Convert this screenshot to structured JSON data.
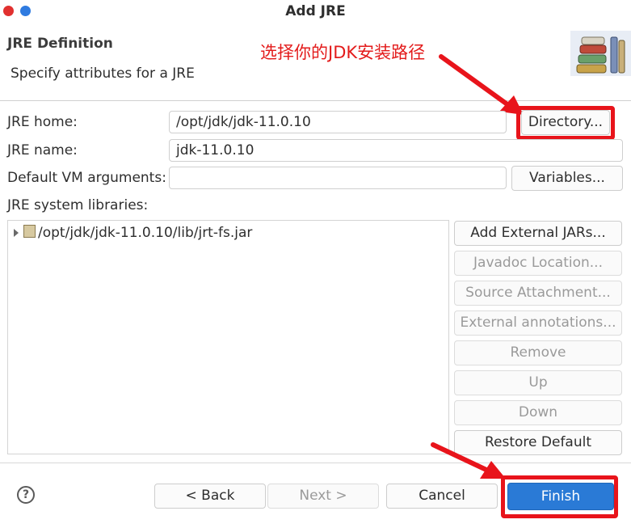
{
  "window": {
    "title": "Add JRE",
    "controls": [
      "close",
      "minimize"
    ],
    "colors": {
      "close": "#e1302f",
      "minimize": "#2f7be0"
    }
  },
  "header": {
    "title": "JRE Definition",
    "subtitle": "Specify attributes for a JRE",
    "annotation": "选择你的JDK安装路径",
    "annotation_color": "#e31b1b",
    "logo_icon": "books-icon"
  },
  "form": {
    "jre_home": {
      "label": "JRE home:",
      "value": "/opt/jdk/jdk-11.0.10",
      "button": "Directory..."
    },
    "jre_name": {
      "label": "JRE name:",
      "value": "jdk-11.0.10"
    },
    "vm_args": {
      "label": "Default VM arguments:",
      "value": "",
      "button": "Variables..."
    },
    "libraries_label": "JRE system libraries:"
  },
  "libraries": [
    {
      "path": "/opt/jdk/jdk-11.0.10/lib/jrt-fs.jar",
      "icon": "jar-icon"
    }
  ],
  "library_buttons": [
    {
      "label": "Add External JARs...",
      "enabled": true
    },
    {
      "label": "Javadoc Location...",
      "enabled": false
    },
    {
      "label": "Source Attachment...",
      "enabled": false
    },
    {
      "label": "External annotations...",
      "enabled": false
    },
    {
      "label": "Remove",
      "enabled": false
    },
    {
      "label": "Up",
      "enabled": false
    },
    {
      "label": "Down",
      "enabled": false
    },
    {
      "label": "Restore Default",
      "enabled": true
    }
  ],
  "footer": {
    "help_icon": "help-icon",
    "back": "< Back",
    "next": "Next >",
    "cancel": "Cancel",
    "finish": "Finish"
  },
  "highlight_color": "#e8141b",
  "accent_color": "#2a7ad6"
}
